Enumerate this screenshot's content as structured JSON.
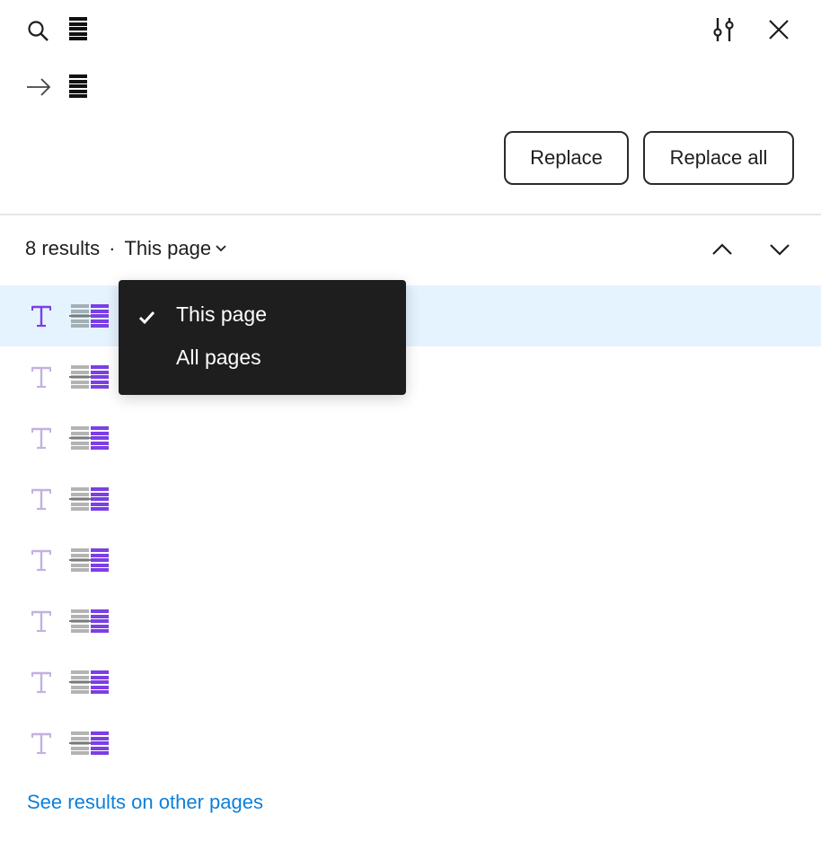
{
  "find": {
    "icon": "search-icon",
    "value_redacted": true
  },
  "replace": {
    "icon": "arrow-right-icon",
    "value_redacted": true
  },
  "toolbar": {
    "settings_icon": "sliders-icon",
    "close_icon": "close-icon",
    "replace_label": "Replace",
    "replace_all_label": "Replace all"
  },
  "results": {
    "count_label": "8 results",
    "separator": "·",
    "scope_label": "This page",
    "prev_icon": "chevron-up-icon",
    "next_icon": "chevron-down-icon",
    "items": [
      {
        "type": "text",
        "selected": true
      },
      {
        "type": "text",
        "selected": false
      },
      {
        "type": "text",
        "selected": false
      },
      {
        "type": "text",
        "selected": false
      },
      {
        "type": "text",
        "selected": false
      },
      {
        "type": "text",
        "selected": false
      },
      {
        "type": "text",
        "selected": false
      },
      {
        "type": "text",
        "selected": false
      }
    ],
    "see_more_label": "See results on other pages"
  },
  "scope_dropdown": {
    "options": [
      {
        "label": "This page",
        "checked": true
      },
      {
        "label": "All pages",
        "checked": false
      }
    ]
  },
  "colors": {
    "accent_purple": "#7b3fe4",
    "link_blue": "#0d7fd9",
    "selected_row_bg": "#e5f3ff",
    "dropdown_bg": "#1e1e1e"
  }
}
